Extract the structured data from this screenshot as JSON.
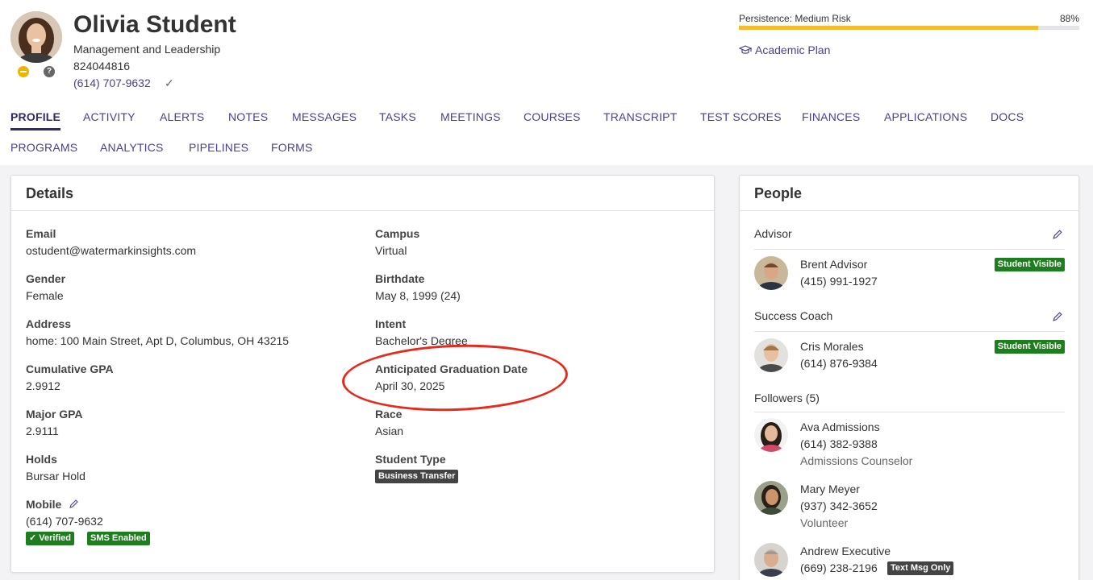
{
  "student": {
    "name": "Olivia Student",
    "major": "Management and Leadership",
    "id": "824044816",
    "phone": "(614) 707-9632",
    "phone_check": "✓",
    "help_icon": "?"
  },
  "persistence": {
    "label": "Persistence: Medium Risk",
    "percent_label": "88%",
    "value": 0.88,
    "bar_color": "#f5bb2e"
  },
  "academic_plan": {
    "label": "Academic Plan",
    "icon": "graduation-cap-icon"
  },
  "nav": {
    "row1": [
      "PROFILE",
      "ACTIVITY",
      "ALERTS",
      "NOTES",
      "MESSAGES",
      "TASKS",
      "MEETINGS",
      "COURSES",
      "TRANSCRIPT",
      "TEST SCORES",
      "FINANCES",
      "APPLICATIONS",
      "DOCS"
    ],
    "row2": [
      "PROGRAMS",
      "ANALYTICS",
      "PIPELINES",
      "FORMS"
    ],
    "active": "PROFILE"
  },
  "details": {
    "title": "Details",
    "left": [
      {
        "label": "Email",
        "value": "ostudent@watermarkinsights.com"
      },
      {
        "label": "Gender",
        "value": "Female"
      },
      {
        "label": "Address",
        "value": "home: 100 Main Street, Apt D, Columbus, OH 43215"
      },
      {
        "label": "Cumulative GPA",
        "value": "2.9912"
      },
      {
        "label": "Major GPA",
        "value": "2.9111"
      },
      {
        "label": "Holds",
        "value": "Bursar Hold"
      },
      {
        "label": "Mobile",
        "value": "(614) 707-9632"
      }
    ],
    "right": [
      {
        "label": "Campus",
        "value": "Virtual"
      },
      {
        "label": "Birthdate",
        "value": "May 8, 1999 (24)"
      },
      {
        "label": "Intent",
        "value": "Bachelor's Degree"
      },
      {
        "label": "Anticipated Graduation Date",
        "value": "April 30, 2025"
      },
      {
        "label": "Race",
        "value": "Asian"
      },
      {
        "label": "Student Type",
        "value": ""
      }
    ],
    "student_type_badge": "Business Transfer",
    "mobile_badges": [
      "✓ Verified",
      "SMS Enabled"
    ]
  },
  "people": {
    "title": "People",
    "advisor_title": "Advisor",
    "advisor": {
      "name": "Brent Advisor",
      "phone": "(415) 991-1927",
      "badge": "Student Visible"
    },
    "coach_title": "Success Coach",
    "coach": {
      "name": "Cris Morales",
      "phone": "(614) 876-9384",
      "badge": "Student Visible"
    },
    "followers_title": "Followers (5)",
    "followers": [
      {
        "name": "Ava Admissions",
        "phone": "(614) 382-9388",
        "role": "Admissions Counselor"
      },
      {
        "name": "Mary Meyer",
        "phone": "(937) 342-3652",
        "role": "Volunteer"
      },
      {
        "name": "Andrew Executive",
        "phone": "(669) 238-2196",
        "badge": "Text Msg Only"
      }
    ]
  }
}
